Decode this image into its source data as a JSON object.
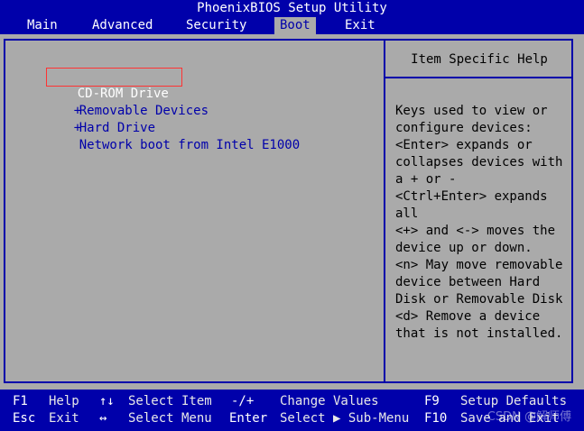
{
  "app": {
    "title": "PhoenixBIOS Setup Utility"
  },
  "menu": {
    "tabs": [
      {
        "label": "Main",
        "active": false
      },
      {
        "label": "Advanced",
        "active": false
      },
      {
        "label": "Security",
        "active": false
      },
      {
        "label": "Boot",
        "active": true
      },
      {
        "label": "Exit",
        "active": false
      }
    ]
  },
  "boot": {
    "items": [
      {
        "prefix": "",
        "label": "CD-ROM Drive",
        "selected": true
      },
      {
        "prefix": "+",
        "label": "Removable Devices",
        "selected": false
      },
      {
        "prefix": "+",
        "label": "Hard Drive",
        "selected": false
      },
      {
        "prefix": "",
        "label": "Network boot from Intel E1000",
        "selected": false
      }
    ]
  },
  "help": {
    "title": "Item Specific Help",
    "lines": [
      "Keys used to view or",
      "configure devices:",
      "<Enter> expands or",
      "collapses devices with",
      "a + or -",
      "<Ctrl+Enter> expands",
      "all",
      "<+> and <-> moves the",
      "device up or down.",
      "<n> May move removable",
      "device between Hard",
      "Disk or Removable Disk",
      "<d> Remove a device",
      "that is not installed."
    ]
  },
  "footer": {
    "row1": [
      {
        "key": "F1",
        "desc": "Help"
      },
      {
        "key": "↑↓",
        "desc": "Select Item"
      },
      {
        "key": "-/+",
        "desc": "Change Values"
      },
      {
        "key": "F9",
        "desc": "Setup Defaults"
      }
    ],
    "row2": [
      {
        "key": "Esc",
        "desc": "Exit"
      },
      {
        "key": "↔",
        "desc": "Select Menu"
      },
      {
        "key": "Enter",
        "desc": "Select ▶ Sub-Menu"
      },
      {
        "key": "F10",
        "desc": "Save and Exit"
      }
    ]
  },
  "watermark": "CSDN @解师傅",
  "colors": {
    "blue": "#0000aa",
    "gray": "#aaaaaa",
    "white": "#ffffff",
    "selection_outline": "#ff3333"
  }
}
